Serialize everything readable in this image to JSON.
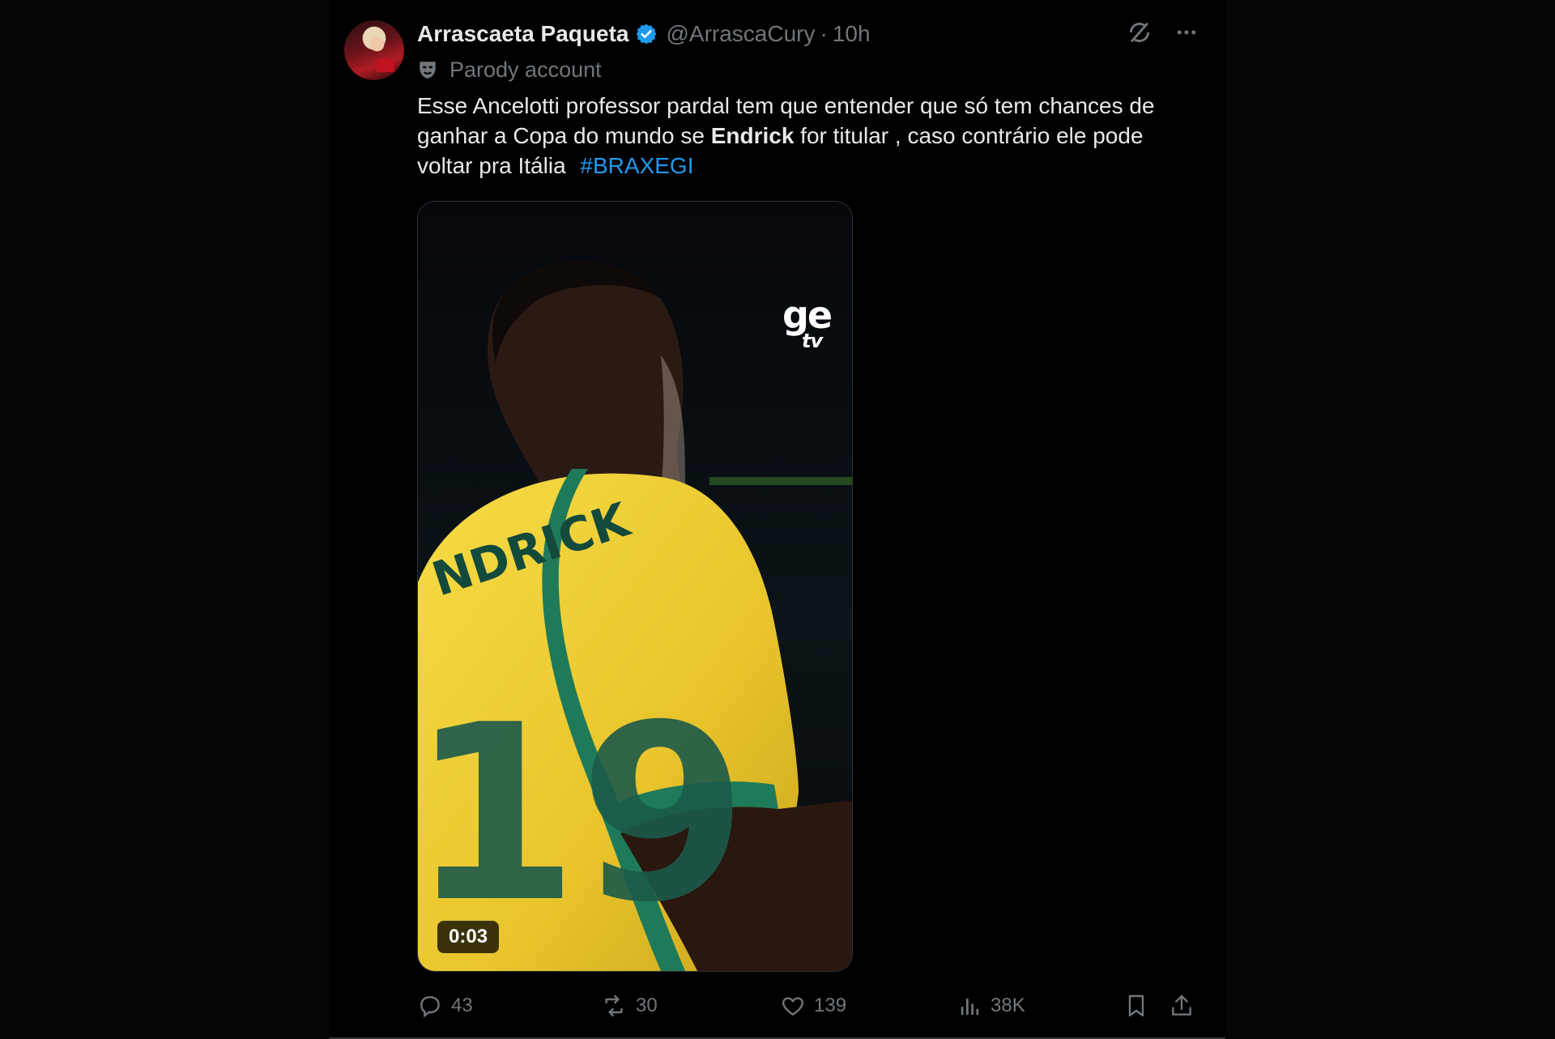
{
  "author": {
    "display_name": "Arrascaeta Paqueta",
    "handle": "@ArrascaCury",
    "separator": "·",
    "time": "10h",
    "label": "Parody account"
  },
  "tweet": {
    "text_part1": "Esse Ancelotti professor pardal tem que entender que só tem chances de ganhar a Copa do mundo se ",
    "text_bold": "Endrick",
    "text_part2": " for titular , caso contrário ele pode voltar pra Itália ",
    "hashtag": "#BRAXEGI"
  },
  "media": {
    "duration": "0:03",
    "watermark_main": "ge",
    "watermark_sub": "tv",
    "jersey_name": "NDRICK",
    "jersey_number": "19"
  },
  "metrics": {
    "replies": "43",
    "reposts": "30",
    "likes": "139",
    "views": "38K"
  },
  "icons": [
    "verified-badge-icon",
    "grok-icon",
    "more-icon",
    "parody-mask-icon",
    "reply-icon",
    "repost-icon",
    "like-icon",
    "views-icon",
    "bookmark-icon",
    "share-icon"
  ],
  "colors": {
    "background": "#000000",
    "text": "#e7e9ea",
    "muted": "#71767b",
    "accent": "#1d9bf0",
    "jersey_yellow": "#f3d23a",
    "jersey_green": "#1f7a5a"
  }
}
